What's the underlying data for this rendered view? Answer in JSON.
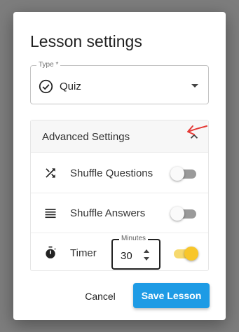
{
  "dialog": {
    "title": "Lesson settings",
    "type_field": {
      "legend": "Type *",
      "value": "Quiz",
      "icon": "check-circle-icon"
    },
    "advanced": {
      "title": "Advanced Settings",
      "expanded": true,
      "rows": [
        {
          "icon": "shuffle-icon",
          "label": "Shuffle Questions",
          "enabled": false
        },
        {
          "icon": "list-icon",
          "label": "Shuffle Answers",
          "enabled": false
        },
        {
          "icon": "stopwatch-icon",
          "label": "Timer",
          "enabled": true,
          "minutes_legend": "Minutes",
          "minutes_value": "30"
        }
      ]
    },
    "actions": {
      "cancel_label": "Cancel",
      "save_label": "Save Lesson"
    }
  },
  "colors": {
    "primary": "#1e9be5",
    "toggle_on": "#f8c62a",
    "annotation": "#e53935"
  }
}
